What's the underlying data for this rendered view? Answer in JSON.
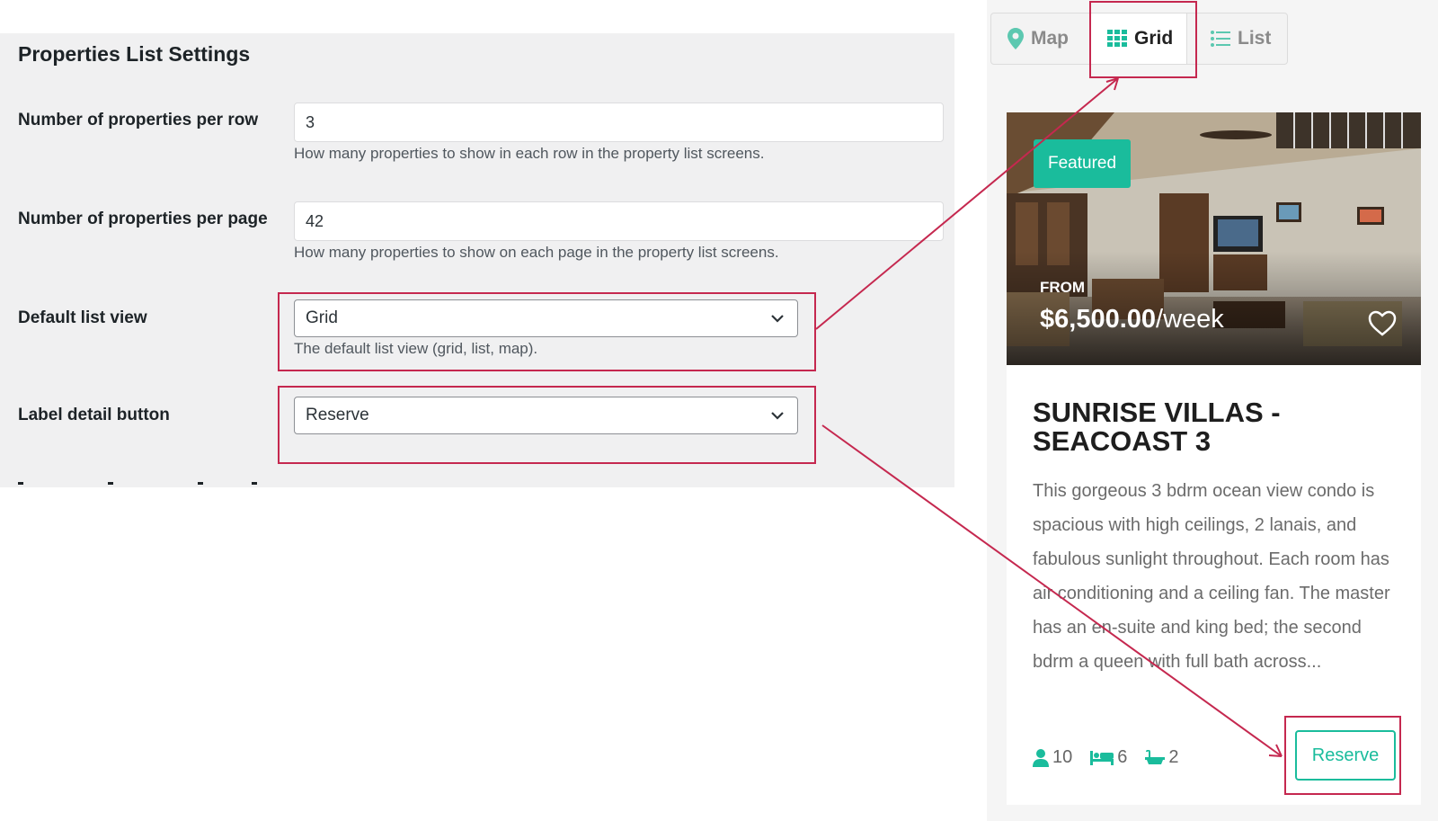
{
  "settings": {
    "title": "Properties List Settings",
    "per_row": {
      "label": "Number of properties per row",
      "value": "3",
      "help": "How many properties to show in each row in the property list screens."
    },
    "per_page": {
      "label": "Number of properties per page",
      "value": "42",
      "help": "How many properties to show on each page in the property list screens."
    },
    "default_view": {
      "label": "Default list view",
      "value": "Grid",
      "help": "The default list view (grid, list, map)."
    },
    "detail_button": {
      "label": "Label detail button",
      "value": "Reserve"
    }
  },
  "view_toggle": {
    "map": "Map",
    "grid": "Grid",
    "list": "List",
    "active": "Grid"
  },
  "card": {
    "badge": "Featured",
    "from": "FROM",
    "price": "$6,500.00",
    "price_unit": "/week",
    "title": "SUNRISE VILLAS - SEACOAST 3",
    "description": "This gorgeous 3 bdrm ocean view condo is spacious with high ceilings, 2 lanais, and fabulous sunlight throughout. Each room has air conditioning and a ceiling fan. The master has an en-suite and king bed; the second bdrm a queen with full bath across...",
    "guests": "10",
    "beds": "6",
    "baths": "2",
    "button": "Reserve"
  },
  "colors": {
    "accent": "#1abc9c",
    "highlight": "#c5284f"
  }
}
